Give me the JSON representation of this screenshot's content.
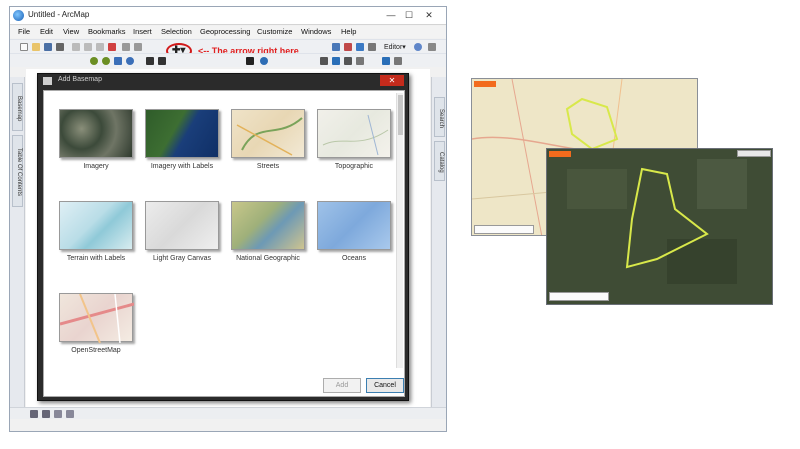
{
  "app": {
    "title": "Untitled - ArcMap",
    "window_buttons": {
      "minimize": "—",
      "maximize": "☐",
      "close": "✕"
    }
  },
  "menubar": {
    "items": [
      "File",
      "Edit",
      "View",
      "Bookmarks",
      "Insert",
      "Selection",
      "Geoprocessing",
      "Customize",
      "Windows",
      "Help"
    ]
  },
  "toolbar": {
    "editor_label": "Editor▾",
    "add_data_glyph": "✚▾"
  },
  "annotation": {
    "text": "<-- The arrow right here",
    "color": "#e02020"
  },
  "docks": {
    "left_tabs": [
      "Basemap",
      "Table Of Contents"
    ],
    "right_tabs": [
      "Search",
      "Catalog"
    ]
  },
  "dialog": {
    "title": "Add Basemap",
    "close_glyph": "✕",
    "basemaps": [
      {
        "label": "Imagery",
        "thumb": "imagery"
      },
      {
        "label": "Imagery with Labels",
        "thumb": "imagery-labels"
      },
      {
        "label": "Streets",
        "thumb": "streets"
      },
      {
        "label": "Topographic",
        "thumb": "topographic"
      },
      {
        "label": "Terrain with Labels",
        "thumb": "terrain"
      },
      {
        "label": "Light Gray Canvas",
        "thumb": "light-gray"
      },
      {
        "label": "National Geographic",
        "thumb": "natgeo"
      },
      {
        "label": "Oceans",
        "thumb": "oceans"
      },
      {
        "label": "OpenStreetMap",
        "thumb": "osm"
      }
    ],
    "add_label": "Add",
    "cancel_label": "Cancel"
  },
  "colors": {
    "boundary": "#d8e84a",
    "dialog_dark": "#2b2b2b",
    "accent_orange": "#f26b1d"
  }
}
